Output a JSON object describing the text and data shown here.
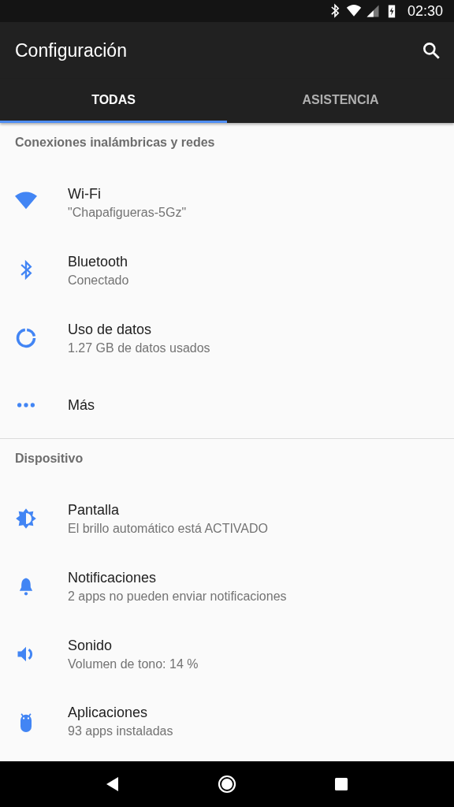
{
  "status_bar": {
    "time": "02:30"
  },
  "toolbar": {
    "title": "Configuración"
  },
  "tabs": [
    {
      "label": "TODAS",
      "selected": true
    },
    {
      "label": "ASISTENCIA",
      "selected": false
    }
  ],
  "sections": [
    {
      "title": "Conexiones inalámbricas y redes",
      "items": [
        {
          "title": "Wi-Fi",
          "summary": "\"Chapafigueras-5Gz\""
        },
        {
          "title": "Bluetooth",
          "summary": "Conectado"
        },
        {
          "title": "Uso de datos",
          "summary": "1.27 GB de datos usados"
        },
        {
          "title": "Más"
        }
      ]
    },
    {
      "title": "Dispositivo",
      "items": [
        {
          "title": "Pantalla",
          "summary": "El brillo automático está ACTIVADO"
        },
        {
          "title": "Notificaciones",
          "summary": "2 apps no pueden enviar notificaciones"
        },
        {
          "title": "Sonido",
          "summary": "Volumen de tono: 14 %"
        },
        {
          "title": "Aplicaciones",
          "summary": "93 apps instaladas"
        }
      ]
    }
  ]
}
